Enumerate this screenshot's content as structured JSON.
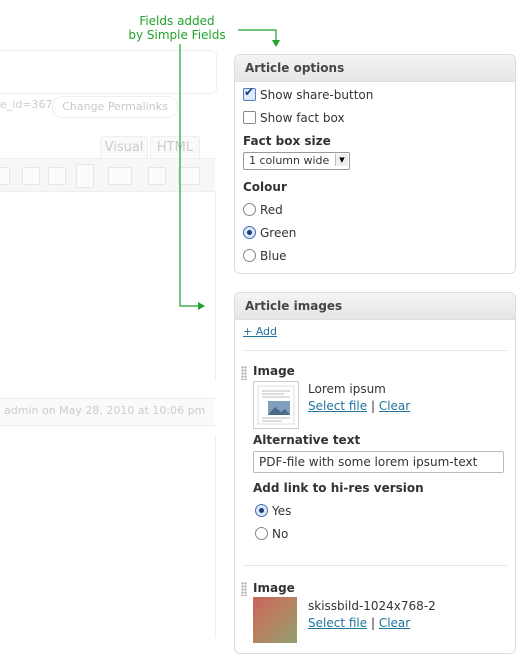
{
  "annotation": {
    "line1": "Fields added",
    "line2": "by Simple Fields",
    "color": "#22a22a"
  },
  "background_editor": {
    "permalink_text": "e_id=367",
    "change_permalinks_label": "Change Permalinks",
    "tab_visual": "Visual",
    "tab_html": "HTML",
    "last_edited": "admin on May 28, 2010 at 10:06 pm"
  },
  "article_options": {
    "title": "Article options",
    "show_share": {
      "label": "Show share-button",
      "checked": true
    },
    "show_fact": {
      "label": "Show fact box",
      "checked": false
    },
    "fact_box_size_label": "Fact box size",
    "fact_box_size_value": "1 column wide",
    "colour_label": "Colour",
    "colour_options": [
      {
        "label": "Red",
        "selected": false
      },
      {
        "label": "Green",
        "selected": true
      },
      {
        "label": "Blue",
        "selected": false
      }
    ]
  },
  "article_images": {
    "title": "Article images",
    "add_label": "+ Add",
    "items": [
      {
        "image_label": "Image",
        "file_name": "Lorem ipsum",
        "select_label": "Select file",
        "divider": "|",
        "clear_label": "Clear",
        "alt_label": "Alternative text",
        "alt_value": "PDF-file with some lorem ipsum-text",
        "hires_label": "Add link to hi-res version",
        "hires_options": [
          {
            "label": "Yes",
            "selected": true
          },
          {
            "label": "No",
            "selected": false
          }
        ]
      },
      {
        "image_label": "Image",
        "file_name": "skissbild-1024x768-2",
        "select_label": "Select file",
        "divider": "|",
        "clear_label": "Clear"
      }
    ]
  },
  "colors": {
    "link": "#21759b",
    "annotation_green": "#22a22a"
  }
}
